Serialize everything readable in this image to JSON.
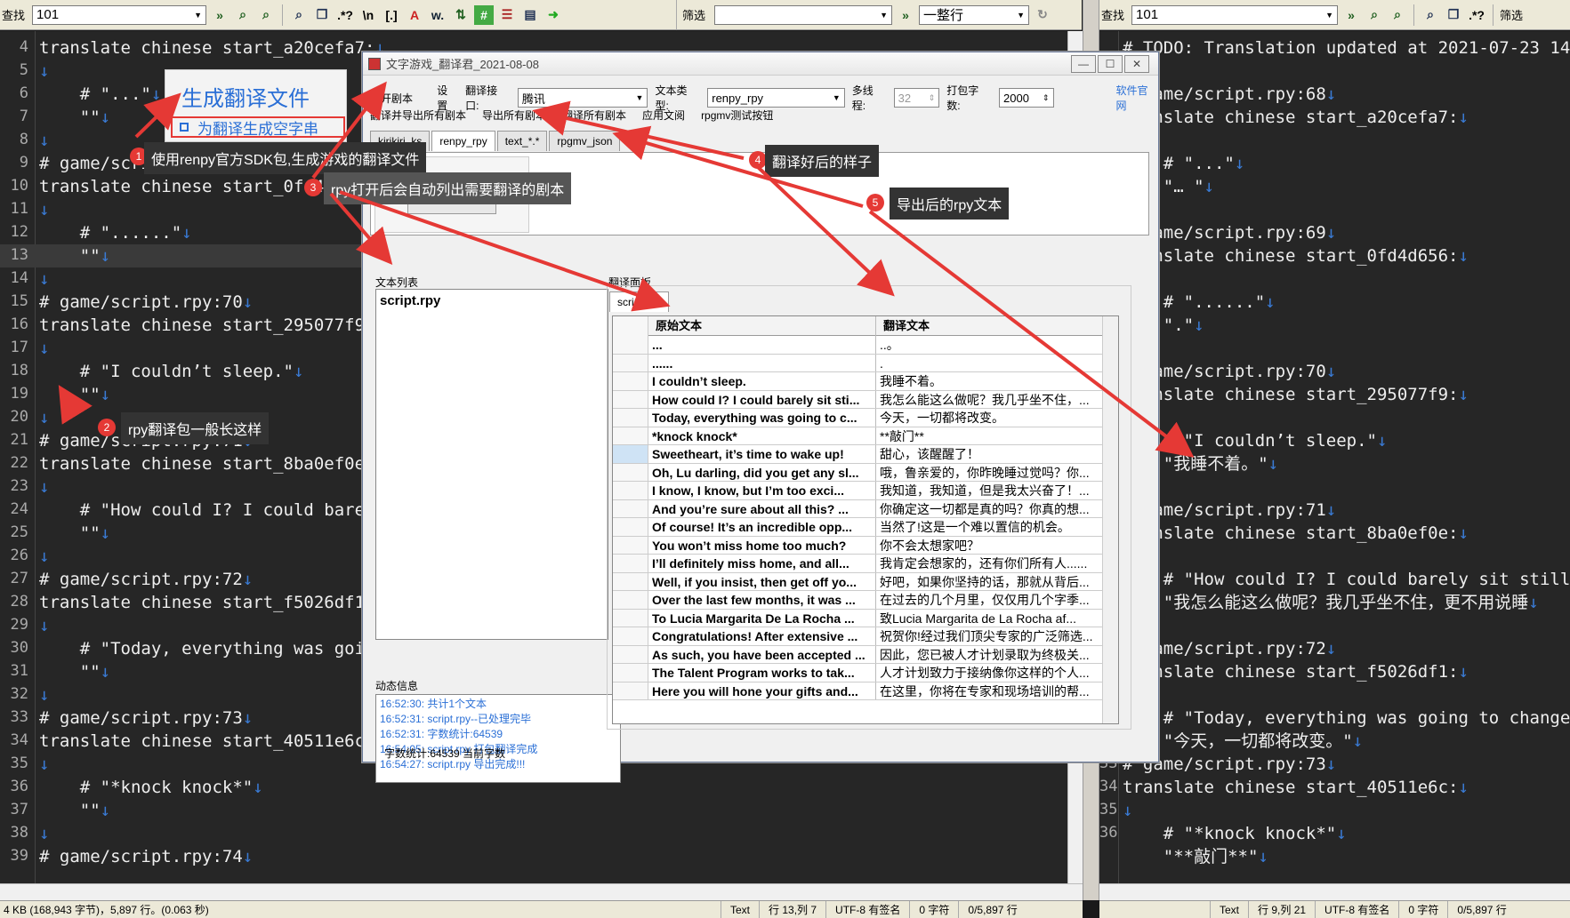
{
  "left_toolbar": {
    "find_label": "查找",
    "find_value": "101"
  },
  "right_toolbar": {
    "find_label": "查找",
    "find_value": "101",
    "filter_label": "筛选",
    "wrap_option": "一整行"
  },
  "left_editor": {
    "lines": [
      {
        "n": "4",
        "text": "translate chinese start_a20cefa7:"
      },
      {
        "n": "5",
        "text": ""
      },
      {
        "n": "6",
        "text": "    # \"...\""
      },
      {
        "n": "7",
        "text": "    \"\""
      },
      {
        "n": "8",
        "text": ""
      },
      {
        "n": "9",
        "text": "# game/script.rpy:69"
      },
      {
        "n": "10",
        "text": "translate chinese start_0fd4d656:"
      },
      {
        "n": "11",
        "text": ""
      },
      {
        "n": "12",
        "text": "    # \"......\""
      },
      {
        "n": "13",
        "text": "    \"\""
      },
      {
        "n": "14",
        "text": ""
      },
      {
        "n": "15",
        "text": "# game/script.rpy:70"
      },
      {
        "n": "16",
        "text": "translate chinese start_295077f9:"
      },
      {
        "n": "17",
        "text": ""
      },
      {
        "n": "18",
        "text": "    # \"I couldn’t sleep.\""
      },
      {
        "n": "19",
        "text": "    \"\""
      },
      {
        "n": "20",
        "text": ""
      },
      {
        "n": "21",
        "text": "# game/script.rpy:71"
      },
      {
        "n": "22",
        "text": "translate chinese start_8ba0ef0e:"
      },
      {
        "n": "23",
        "text": ""
      },
      {
        "n": "24",
        "text": "    # \"How could I? I could barely"
      },
      {
        "n": "25",
        "text": "    \"\""
      },
      {
        "n": "26",
        "text": ""
      },
      {
        "n": "27",
        "text": "# game/script.rpy:72"
      },
      {
        "n": "28",
        "text": "translate chinese start_f5026df1:"
      },
      {
        "n": "29",
        "text": ""
      },
      {
        "n": "30",
        "text": "    # \"Today, everything was going"
      },
      {
        "n": "31",
        "text": "    \"\""
      },
      {
        "n": "32",
        "text": ""
      },
      {
        "n": "33",
        "text": "# game/script.rpy:73"
      },
      {
        "n": "34",
        "text": "translate chinese start_40511e6c:"
      },
      {
        "n": "35",
        "text": ""
      },
      {
        "n": "36",
        "text": "    # \"*knock knock*\""
      },
      {
        "n": "37",
        "text": "    \"\""
      },
      {
        "n": "38",
        "text": ""
      },
      {
        "n": "39",
        "text": "# game/script.rpy:74"
      }
    ]
  },
  "right_editor": {
    "lines": [
      {
        "n": "",
        "text": "# TODO: Translation updated at 2021-07-23 14:4"
      },
      {
        "n": "",
        "text": ""
      },
      {
        "n": "",
        "text": "# game/script.rpy:68"
      },
      {
        "n": "",
        "text": "translate chinese start_a20cefa7:"
      },
      {
        "n": "",
        "text": ""
      },
      {
        "n": "",
        "text": "    # \"...\""
      },
      {
        "n": "",
        "text": "    \"… \""
      },
      {
        "n": "",
        "text": ""
      },
      {
        "n": "",
        "text": "# game/script.rpy:69"
      },
      {
        "n": "",
        "text": "translate chinese start_0fd4d656:"
      },
      {
        "n": "",
        "text": ""
      },
      {
        "n": "",
        "text": "    # \"......\""
      },
      {
        "n": "",
        "text": "    \".\""
      },
      {
        "n": "",
        "text": ""
      },
      {
        "n": "",
        "text": "# game/script.rpy:70"
      },
      {
        "n": "",
        "text": "translate chinese start_295077f9:"
      },
      {
        "n": "",
        "text": ""
      },
      {
        "n": "",
        "text": "    # \"I couldn’t sleep.\""
      },
      {
        "n": "",
        "text": "    \"我睡不着。\""
      },
      {
        "n": "",
        "text": ""
      },
      {
        "n": "",
        "text": "# game/script.rpy:71"
      },
      {
        "n": "",
        "text": "translate chinese start_8ba0ef0e:"
      },
      {
        "n": "",
        "text": ""
      },
      {
        "n": "",
        "text": "    # \"How could I? I could barely sit still,"
      },
      {
        "n": "",
        "text": "    \"我怎么能这么做呢？我几乎坐不住，更不用说睡"
      },
      {
        "n": "",
        "text": ""
      },
      {
        "n": "",
        "text": "# game/script.rpy:72"
      },
      {
        "n": "",
        "text": "translate chinese start_f5026df1:"
      },
      {
        "n": "",
        "text": ""
      },
      {
        "n": "",
        "text": "    # \"Today, everything was going to change.\""
      },
      {
        "n": "32",
        "text": "    \"今天，一切都将改变。\""
      },
      {
        "n": "33",
        "text": "# game/script.rpy:73"
      },
      {
        "n": "34",
        "text": "translate chinese start_40511e6c:"
      },
      {
        "n": "35",
        "text": ""
      },
      {
        "n": "36",
        "text": "    # \"*knock knock*\""
      },
      {
        "n": "",
        "text": "    \"**敲门**\""
      }
    ]
  },
  "left_status": {
    "file": "4 KB (168,943 字节)，5,897 行。(0.063 秒)",
    "mode": "Text",
    "pos": "行 13,列 7",
    "enc": "UTF-8 有签名",
    "chars": "0 字符",
    "lines": "0/5,897 行"
  },
  "right_status": {
    "mode": "Text",
    "pos": "行 9,列 21",
    "enc": "UTF-8 有签名",
    "chars": "0 字符",
    "lines": "0/5,897 行"
  },
  "dialog": {
    "title": "文字游戏_翻译君_2021-08-08",
    "toolbar": {
      "open": "打开剧本",
      "settings": "设置",
      "api_label": "翻译接口:",
      "api_value": "腾讯",
      "type_label": "文本类型:",
      "type_value": "renpy_rpy",
      "threads_label": "多线程:",
      "threads_value": "32",
      "pack_label": "打包字数:",
      "pack_value": "2000",
      "website": "软件官网"
    },
    "menu": [
      "翻译并导出所有剧本",
      "导出所有剧本",
      "翻译所有剧本",
      "应用文阅",
      "rpgmv测试按钮"
    ],
    "tabs": [
      "kirikiri_ks",
      "renpy_rpy",
      "text_*.*",
      "rpgmv_json"
    ],
    "text_list_label": "文本列表",
    "text_list": [
      "script.rpy"
    ],
    "translate_panel_label": "翻译面板",
    "translate_tab": "script.rpy",
    "grid_headers": [
      "原始文本",
      "翻译文本"
    ],
    "rows": [
      [
        "...",
        "..。"
      ],
      [
        "......",
        "."
      ],
      [
        "I couldn’t sleep.",
        "我睡不着。"
      ],
      [
        "How could I? I could barely sit sti...",
        "我怎么能这么做呢？我几乎坐不住，..."
      ],
      [
        "Today, everything was going to c...",
        "今天，一切都将改变。"
      ],
      [
        "*knock knock*",
        "**敲门**"
      ],
      [
        "Sweetheart, it’s time to wake up!",
        "甜心，该醒醒了！"
      ],
      [
        "Oh, Lu darling, did you get any sl...",
        "哦，鲁亲爱的，你昨晚睡过觉吗？你..."
      ],
      [
        "I know, I know, but I’m too exci...",
        "我知道，我知道，但是我太兴奋了！..."
      ],
      [
        "And you’re sure about all this? ...",
        "你确定这一切都是真的吗？你真的想..."
      ],
      [
        "Of course! It’s an incredible opp...",
        "当然了!这是一个难以置信的机会。"
      ],
      [
        "You won’t miss home too much?",
        "你不会太想家吧？"
      ],
      [
        "I’ll definitely miss home, and all...",
        "我肯定会想家的，还有你们所有人......"
      ],
      [
        "Well, if you insist, then get off yo...",
        "好吧，如果你坚持的话，那就从背后..."
      ],
      [
        "Over the last few months, it was ...",
        "在过去的几个月里，仅仅用几个字季..."
      ],
      [
        "To Lucia Margarita De La Rocha ...",
        "致Lucia Margarita de La Rocha af..."
      ],
      [
        "Congratulations! After extensive ...",
        "祝贺你!经过我们顶尖专家的广泛筛选..."
      ],
      [
        "As such, you have been accepted ...",
        "因此，您已被人才计划录取为终极关..."
      ],
      [
        "The Talent Program works to tak...",
        "人才计划致力于接纳像你这样的个人..."
      ],
      [
        "Here you will hone your gifts and...",
        "在这里，你将在专家和现场培训的帮..."
      ]
    ],
    "log_label": "动态信息",
    "log": [
      "16:52:30: 共计1个文本",
      "16:52:31: script.rpy--已处理完毕",
      "16:52:31: 字数统计:64539",
      "16:54:05: script.rpy 打包翻译完成",
      "16:54:27: script.rpy 导出完成!!!"
    ],
    "status": "字数统计:64539  当前字数"
  },
  "sdk_popup": {
    "title": "生成翻译文件",
    "checkbox": "为翻译生成空字串"
  },
  "callouts": [
    {
      "n": "1",
      "text": "使用renpy官方SDK包,生成游戏的翻译文件"
    },
    {
      "n": "2",
      "text": "rpy翻译包一般长这样"
    },
    {
      "n": "3",
      "text": "rpy打开后会自动列出需要翻译的剧本"
    },
    {
      "n": "4",
      "text": "翻译好后的样子"
    },
    {
      "n": "5",
      "text": "导出后的rpy文本"
    }
  ],
  "colors": {
    "editor_bg": "#262626",
    "callout_bg": "#333333",
    "arrow": "#e53935",
    "log_text": "#2a6fd6",
    "newline_mark": "#3a7bd5"
  }
}
